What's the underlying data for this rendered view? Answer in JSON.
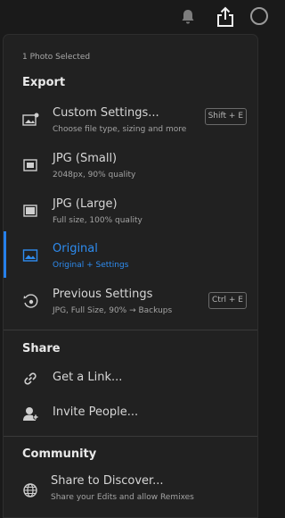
{
  "topbar": {
    "icons": [
      "bell-icon",
      "share-export-icon",
      "profile-icon"
    ]
  },
  "menu": {
    "caption": "1 Photo Selected",
    "export_title": "Export",
    "items": [
      {
        "title": "Custom Settings...",
        "subtitle": "Choose file type, sizing and more",
        "shortcut": "Shift + E",
        "icon": "custom-settings-icon"
      },
      {
        "title": "JPG (Small)",
        "subtitle": "2048px, 90% quality",
        "icon": "jpg-small-icon"
      },
      {
        "title": "JPG (Large)",
        "subtitle": "Full size, 100% quality",
        "icon": "jpg-large-icon"
      },
      {
        "title": "Original",
        "subtitle": "Original + Settings",
        "icon": "original-image-icon",
        "selected": true
      },
      {
        "title": "Previous Settings",
        "subtitle": "JPG, Full Size, 90% → Backups",
        "shortcut": "Ctrl + E",
        "icon": "history-icon"
      }
    ],
    "share_title": "Share",
    "share_items": [
      {
        "title": "Get a Link...",
        "icon": "link-icon"
      },
      {
        "title": "Invite People...",
        "icon": "invite-person-icon"
      }
    ],
    "community_title": "Community",
    "community_items": [
      {
        "title": "Share to Discover...",
        "subtitle": "Share your Edits and allow Remixes",
        "icon": "globe-icon"
      }
    ]
  },
  "colors": {
    "accent": "#2680eb",
    "selected_text": "#2e8cf0",
    "panel_bg": "#212121",
    "page_bg": "#1a1a1a"
  }
}
